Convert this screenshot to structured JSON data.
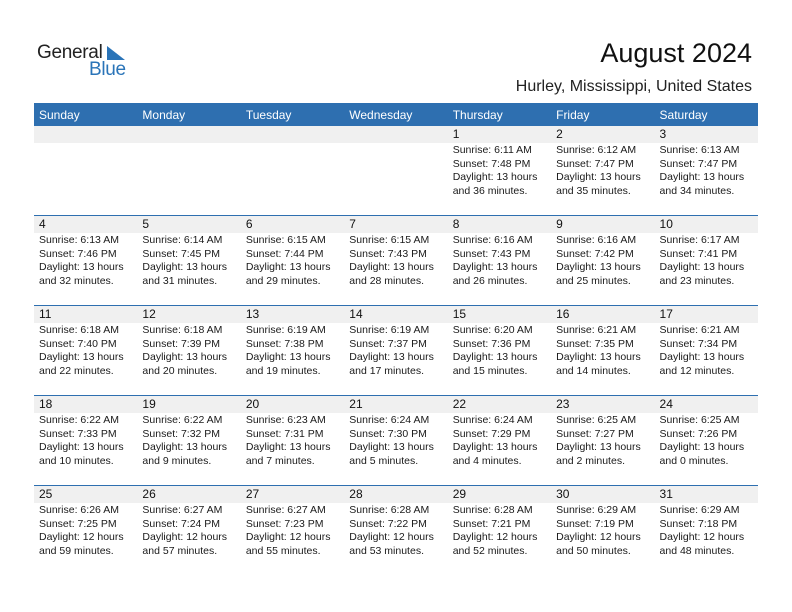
{
  "logo": {
    "text_general": "General",
    "text_blue": "Blue",
    "icon": "triangle-flag-icon",
    "brand_color": "#2a74b8"
  },
  "header": {
    "title": "August 2024",
    "location": "Hurley, Mississippi, United States"
  },
  "colors": {
    "header_bg": "#2e6fb0",
    "date_band_bg": "#f0f0f0"
  },
  "weekdays": [
    "Sunday",
    "Monday",
    "Tuesday",
    "Wednesday",
    "Thursday",
    "Friday",
    "Saturday"
  ],
  "weeks": [
    [
      null,
      null,
      null,
      null,
      {
        "day": "1",
        "sunrise": "Sunrise: 6:11 AM",
        "sunset": "Sunset: 7:48 PM",
        "daylight1": "Daylight: 13 hours",
        "daylight2": "and 36 minutes."
      },
      {
        "day": "2",
        "sunrise": "Sunrise: 6:12 AM",
        "sunset": "Sunset: 7:47 PM",
        "daylight1": "Daylight: 13 hours",
        "daylight2": "and 35 minutes."
      },
      {
        "day": "3",
        "sunrise": "Sunrise: 6:13 AM",
        "sunset": "Sunset: 7:47 PM",
        "daylight1": "Daylight: 13 hours",
        "daylight2": "and 34 minutes."
      }
    ],
    [
      {
        "day": "4",
        "sunrise": "Sunrise: 6:13 AM",
        "sunset": "Sunset: 7:46 PM",
        "daylight1": "Daylight: 13 hours",
        "daylight2": "and 32 minutes."
      },
      {
        "day": "5",
        "sunrise": "Sunrise: 6:14 AM",
        "sunset": "Sunset: 7:45 PM",
        "daylight1": "Daylight: 13 hours",
        "daylight2": "and 31 minutes."
      },
      {
        "day": "6",
        "sunrise": "Sunrise: 6:15 AM",
        "sunset": "Sunset: 7:44 PM",
        "daylight1": "Daylight: 13 hours",
        "daylight2": "and 29 minutes."
      },
      {
        "day": "7",
        "sunrise": "Sunrise: 6:15 AM",
        "sunset": "Sunset: 7:43 PM",
        "daylight1": "Daylight: 13 hours",
        "daylight2": "and 28 minutes."
      },
      {
        "day": "8",
        "sunrise": "Sunrise: 6:16 AM",
        "sunset": "Sunset: 7:43 PM",
        "daylight1": "Daylight: 13 hours",
        "daylight2": "and 26 minutes."
      },
      {
        "day": "9",
        "sunrise": "Sunrise: 6:16 AM",
        "sunset": "Sunset: 7:42 PM",
        "daylight1": "Daylight: 13 hours",
        "daylight2": "and 25 minutes."
      },
      {
        "day": "10",
        "sunrise": "Sunrise: 6:17 AM",
        "sunset": "Sunset: 7:41 PM",
        "daylight1": "Daylight: 13 hours",
        "daylight2": "and 23 minutes."
      }
    ],
    [
      {
        "day": "11",
        "sunrise": "Sunrise: 6:18 AM",
        "sunset": "Sunset: 7:40 PM",
        "daylight1": "Daylight: 13 hours",
        "daylight2": "and 22 minutes."
      },
      {
        "day": "12",
        "sunrise": "Sunrise: 6:18 AM",
        "sunset": "Sunset: 7:39 PM",
        "daylight1": "Daylight: 13 hours",
        "daylight2": "and 20 minutes."
      },
      {
        "day": "13",
        "sunrise": "Sunrise: 6:19 AM",
        "sunset": "Sunset: 7:38 PM",
        "daylight1": "Daylight: 13 hours",
        "daylight2": "and 19 minutes."
      },
      {
        "day": "14",
        "sunrise": "Sunrise: 6:19 AM",
        "sunset": "Sunset: 7:37 PM",
        "daylight1": "Daylight: 13 hours",
        "daylight2": "and 17 minutes."
      },
      {
        "day": "15",
        "sunrise": "Sunrise: 6:20 AM",
        "sunset": "Sunset: 7:36 PM",
        "daylight1": "Daylight: 13 hours",
        "daylight2": "and 15 minutes."
      },
      {
        "day": "16",
        "sunrise": "Sunrise: 6:21 AM",
        "sunset": "Sunset: 7:35 PM",
        "daylight1": "Daylight: 13 hours",
        "daylight2": "and 14 minutes."
      },
      {
        "day": "17",
        "sunrise": "Sunrise: 6:21 AM",
        "sunset": "Sunset: 7:34 PM",
        "daylight1": "Daylight: 13 hours",
        "daylight2": "and 12 minutes."
      }
    ],
    [
      {
        "day": "18",
        "sunrise": "Sunrise: 6:22 AM",
        "sunset": "Sunset: 7:33 PM",
        "daylight1": "Daylight: 13 hours",
        "daylight2": "and 10 minutes."
      },
      {
        "day": "19",
        "sunrise": "Sunrise: 6:22 AM",
        "sunset": "Sunset: 7:32 PM",
        "daylight1": "Daylight: 13 hours",
        "daylight2": "and 9 minutes."
      },
      {
        "day": "20",
        "sunrise": "Sunrise: 6:23 AM",
        "sunset": "Sunset: 7:31 PM",
        "daylight1": "Daylight: 13 hours",
        "daylight2": "and 7 minutes."
      },
      {
        "day": "21",
        "sunrise": "Sunrise: 6:24 AM",
        "sunset": "Sunset: 7:30 PM",
        "daylight1": "Daylight: 13 hours",
        "daylight2": "and 5 minutes."
      },
      {
        "day": "22",
        "sunrise": "Sunrise: 6:24 AM",
        "sunset": "Sunset: 7:29 PM",
        "daylight1": "Daylight: 13 hours",
        "daylight2": "and 4 minutes."
      },
      {
        "day": "23",
        "sunrise": "Sunrise: 6:25 AM",
        "sunset": "Sunset: 7:27 PM",
        "daylight1": "Daylight: 13 hours",
        "daylight2": "and 2 minutes."
      },
      {
        "day": "24",
        "sunrise": "Sunrise: 6:25 AM",
        "sunset": "Sunset: 7:26 PM",
        "daylight1": "Daylight: 13 hours",
        "daylight2": "and 0 minutes."
      }
    ],
    [
      {
        "day": "25",
        "sunrise": "Sunrise: 6:26 AM",
        "sunset": "Sunset: 7:25 PM",
        "daylight1": "Daylight: 12 hours",
        "daylight2": "and 59 minutes."
      },
      {
        "day": "26",
        "sunrise": "Sunrise: 6:27 AM",
        "sunset": "Sunset: 7:24 PM",
        "daylight1": "Daylight: 12 hours",
        "daylight2": "and 57 minutes."
      },
      {
        "day": "27",
        "sunrise": "Sunrise: 6:27 AM",
        "sunset": "Sunset: 7:23 PM",
        "daylight1": "Daylight: 12 hours",
        "daylight2": "and 55 minutes."
      },
      {
        "day": "28",
        "sunrise": "Sunrise: 6:28 AM",
        "sunset": "Sunset: 7:22 PM",
        "daylight1": "Daylight: 12 hours",
        "daylight2": "and 53 minutes."
      },
      {
        "day": "29",
        "sunrise": "Sunrise: 6:28 AM",
        "sunset": "Sunset: 7:21 PM",
        "daylight1": "Daylight: 12 hours",
        "daylight2": "and 52 minutes."
      },
      {
        "day": "30",
        "sunrise": "Sunrise: 6:29 AM",
        "sunset": "Sunset: 7:19 PM",
        "daylight1": "Daylight: 12 hours",
        "daylight2": "and 50 minutes."
      },
      {
        "day": "31",
        "sunrise": "Sunrise: 6:29 AM",
        "sunset": "Sunset: 7:18 PM",
        "daylight1": "Daylight: 12 hours",
        "daylight2": "and 48 minutes."
      }
    ]
  ]
}
